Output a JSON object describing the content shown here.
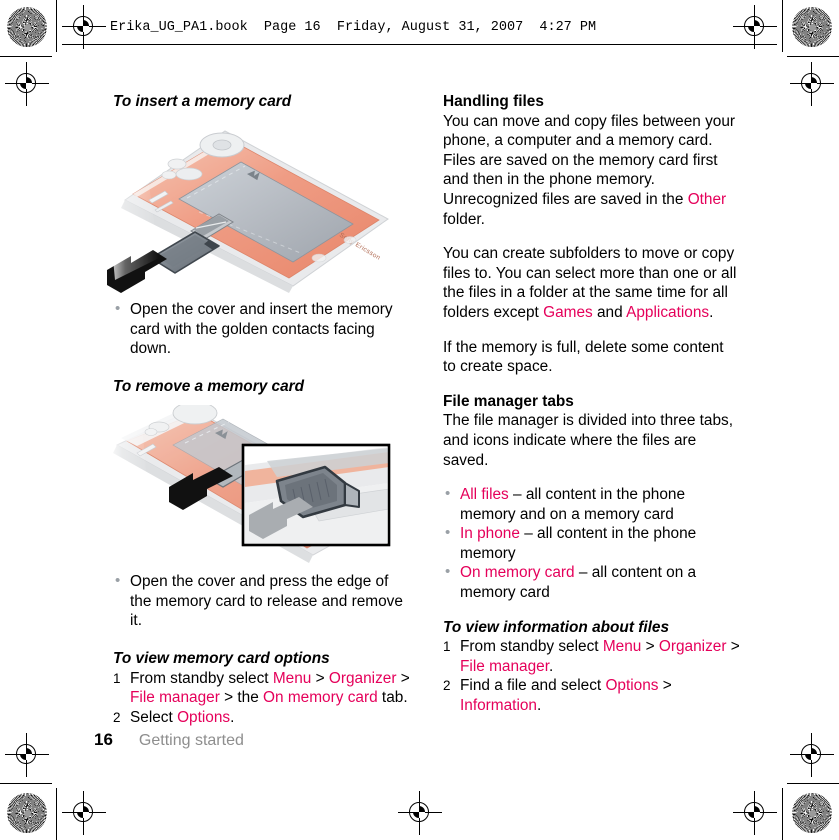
{
  "header": {
    "file_line": "Erika_UG_PA1.book  Page 16  Friday, August 31, 2007  4:27 PM"
  },
  "footer": {
    "page_number": "16",
    "chapter": "Getting started"
  },
  "colors": {
    "ui_reference": "#e5005a",
    "phone_body": "#ef9c84",
    "phone_screen": "#b9bdc4",
    "chapter_gray": "#8e8e8e"
  },
  "left_column": {
    "heading_insert": "To insert a memory card",
    "figure_insert_alt": "Phone with memory card being inserted into the card slot, black arrow pointing in",
    "bullet_insert": "Open the cover and insert the memory card with the golden contacts facing down.",
    "heading_remove": "To remove a memory card",
    "figure_remove_alt": "Phone card slot with inset detail view, black arrow pressing card and gray arrow showing card ejecting",
    "bullet_remove": "Open the cover and press the edge of the memory card to release and remove it.",
    "heading_options": "To view memory card options",
    "steps": [
      {
        "parts": [
          {
            "text": "From standby select ",
            "style": "plain"
          },
          {
            "text": "Menu",
            "style": "ref"
          },
          {
            "text": " > ",
            "style": "plain"
          },
          {
            "text": "Organizer",
            "style": "ref"
          },
          {
            "text": " > ",
            "style": "plain"
          },
          {
            "text": "File manager",
            "style": "ref"
          },
          {
            "text": " > the ",
            "style": "plain"
          },
          {
            "text": "On memory card",
            "style": "ref"
          },
          {
            "text": " tab.",
            "style": "plain"
          }
        ]
      },
      {
        "parts": [
          {
            "text": "Select ",
            "style": "plain"
          },
          {
            "text": "Options",
            "style": "ref"
          },
          {
            "text": ".",
            "style": "plain"
          }
        ]
      }
    ]
  },
  "right_column": {
    "heading_handling": "Handling files",
    "para_handling": [
      {
        "text": "You can move and copy files between your phone, a computer and a memory card. Files are saved on the memory card first and then in the phone memory. Unrecognized files are saved in the ",
        "style": "plain"
      },
      {
        "text": "Other",
        "style": "ref"
      },
      {
        "text": " folder.",
        "style": "plain"
      }
    ],
    "para_subfolders": [
      {
        "text": "You can create subfolders to move or copy files to. You can select more than one or all the files in a folder at the same time for all folders except ",
        "style": "plain"
      },
      {
        "text": "Games",
        "style": "ref"
      },
      {
        "text": " and ",
        "style": "plain"
      },
      {
        "text": "Applications",
        "style": "ref"
      },
      {
        "text": ".",
        "style": "plain"
      }
    ],
    "para_memory_full": "If the memory is full, delete some content to create space.",
    "heading_tabs": "File manager tabs",
    "para_tabs": "The file manager is divided into three tabs, and icons indicate where the files are saved.",
    "tab_bullets": [
      [
        {
          "text": "All files",
          "style": "ref"
        },
        {
          "text": " – all content in the phone memory and on a memory card",
          "style": "plain"
        }
      ],
      [
        {
          "text": "In phone",
          "style": "ref"
        },
        {
          "text": " – all content in the phone memory",
          "style": "plain"
        }
      ],
      [
        {
          "text": "On memory card",
          "style": "ref"
        },
        {
          "text": " – all content on a memory card",
          "style": "plain"
        }
      ]
    ],
    "heading_info": "To view information about files",
    "steps": [
      {
        "parts": [
          {
            "text": "From standby select ",
            "style": "plain"
          },
          {
            "text": "Menu",
            "style": "ref"
          },
          {
            "text": " > ",
            "style": "plain"
          },
          {
            "text": "Organizer",
            "style": "ref"
          },
          {
            "text": " > ",
            "style": "plain"
          },
          {
            "text": "File manager",
            "style": "ref"
          },
          {
            "text": ".",
            "style": "plain"
          }
        ]
      },
      {
        "parts": [
          {
            "text": "Find a file and select ",
            "style": "plain"
          },
          {
            "text": "Options",
            "style": "ref"
          },
          {
            "text": " > ",
            "style": "plain"
          },
          {
            "text": "Information",
            "style": "ref"
          },
          {
            "text": ".",
            "style": "plain"
          }
        ]
      }
    ]
  }
}
